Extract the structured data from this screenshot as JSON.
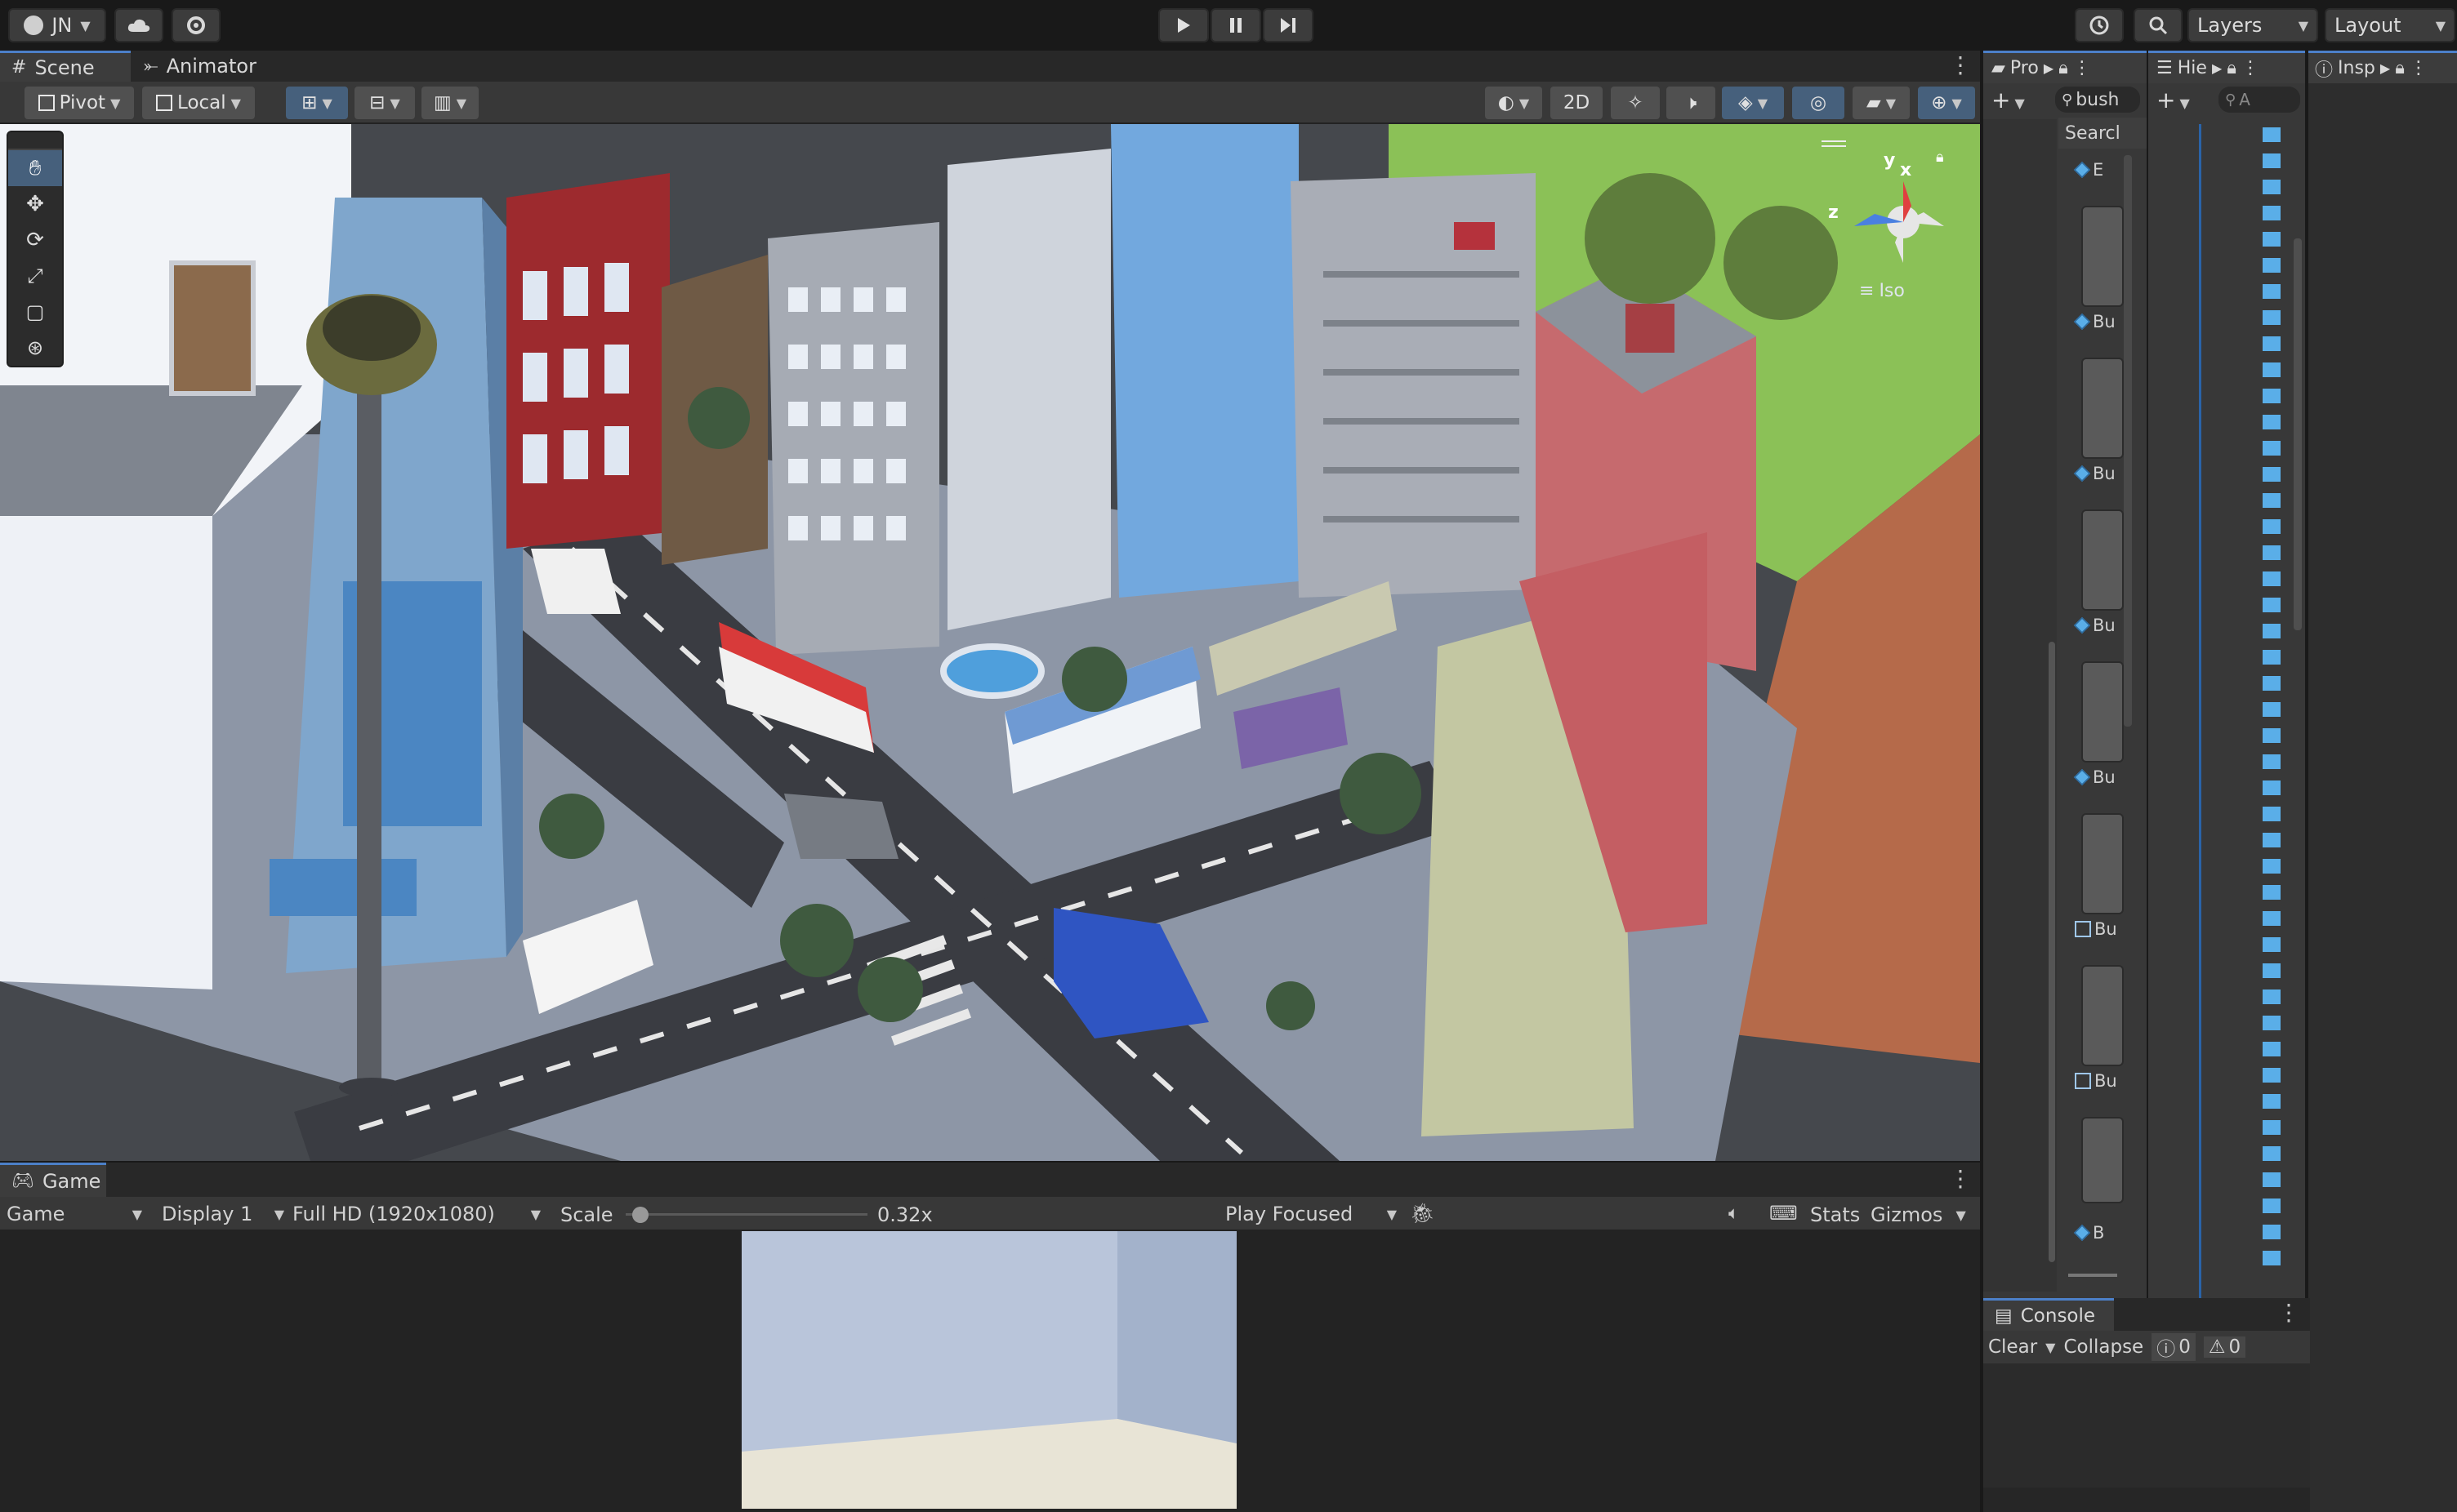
{
  "topbar": {
    "account": "JN",
    "layers_label": "Layers",
    "layout_label": "Layout"
  },
  "scene_tabs": [
    {
      "label": "Scene"
    },
    {
      "label": "Animator"
    }
  ],
  "scene_toolbar": {
    "pivot_label": "Pivot",
    "local_label": "Local",
    "mode_2d_label": "2D"
  },
  "scene_gizmo": {
    "axis_y": "y",
    "axis_x": "x",
    "axis_z": "z",
    "projection_label": "Iso"
  },
  "game_panel": {
    "tab_label": "Game",
    "view_select": "Game",
    "display_select": "Display 1",
    "resolution_select": "Full HD (1920x1080)",
    "scale_label": "Scale",
    "scale_value": "0.32x",
    "scale_fraction": 0.03,
    "play_mode_select": "Play Focused",
    "stats_label": "Stats",
    "gizmos_label": "Gizmos"
  },
  "project_panel": {
    "tab_label": "Pro",
    "search_value": "bush",
    "search_header": "Searcl",
    "items": [
      {
        "label": "E",
        "icon": "prefab-icon"
      },
      {
        "label": "Bu",
        "icon": "prefab-icon"
      },
      {
        "label": "Bu",
        "icon": "prefab-icon"
      },
      {
        "label": "Bu",
        "icon": "prefab-icon"
      },
      {
        "label": "Bu",
        "icon": "prefab-icon"
      },
      {
        "label": "Bu",
        "icon": "mesh-grid-icon"
      },
      {
        "label": "Bu",
        "icon": "mesh-grid-icon"
      },
      {
        "label": "B",
        "icon": "prefab-icon"
      }
    ]
  },
  "hierarchy_panel": {
    "tab_label": "Hie",
    "search_placeholder": "A"
  },
  "inspector_panel": {
    "tab_label": "Insp"
  },
  "console_panel": {
    "tab_label": "Console",
    "clear_label": "Clear",
    "collapse_label": "Collapse",
    "info_count": "0",
    "warning_count": "0"
  },
  "colors": {
    "accent": "#4c80c9",
    "prefab_blue": "#5aaee8",
    "editor_bg": "#383838",
    "topbar_bg": "#191919"
  }
}
